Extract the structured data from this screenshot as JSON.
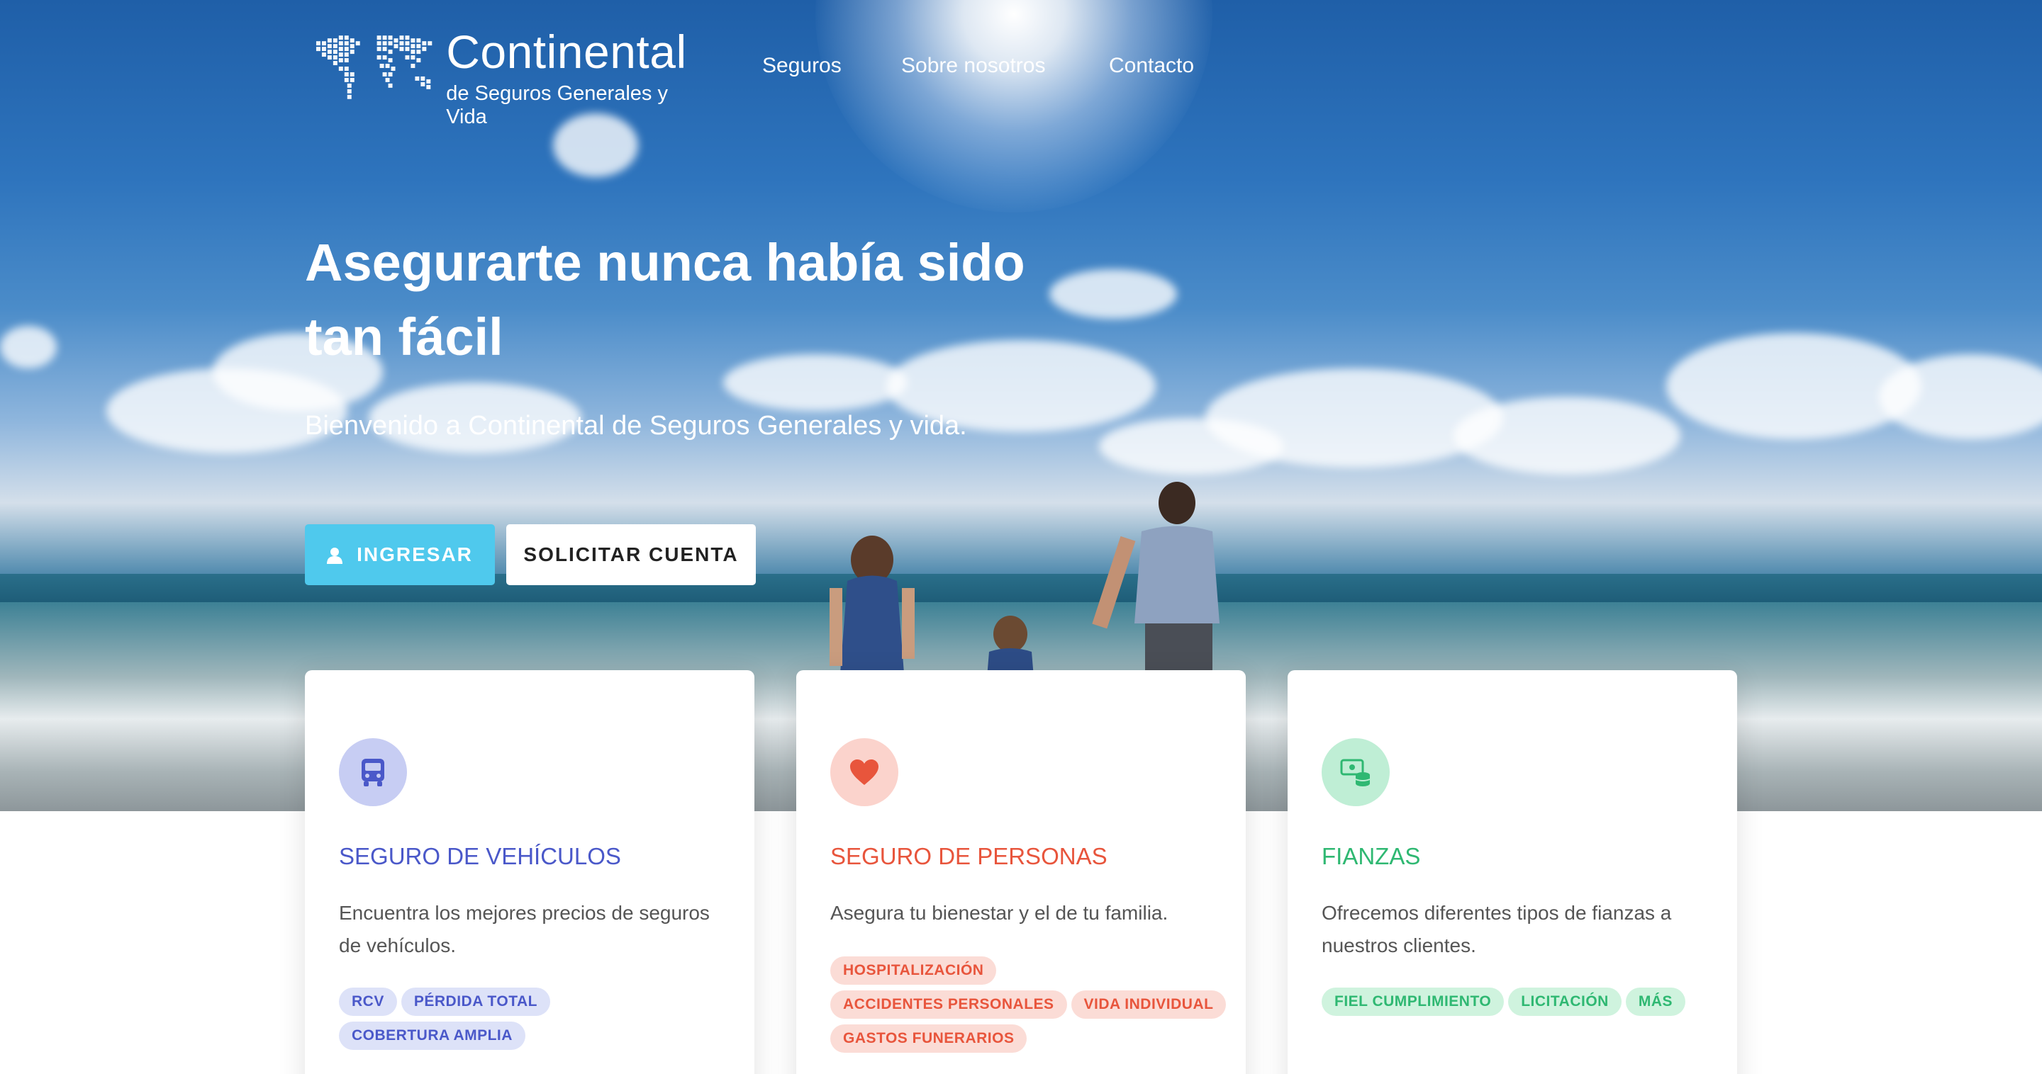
{
  "brand": {
    "name": "Continental",
    "tagline": "de Seguros Generales y Vida"
  },
  "nav": {
    "items": [
      {
        "label": "Seguros"
      },
      {
        "label": "Sobre nosotros"
      },
      {
        "label": "Contacto"
      }
    ]
  },
  "hero": {
    "title_line1": "Asegurarte nunca había sido",
    "title_line2": "tan fácil",
    "subtitle": "Bienvenido a Continental de Seguros Generales y vida.",
    "login_label": "INGRESAR",
    "login_icon": "user-icon",
    "signup_label": "SOLICITAR CUENTA"
  },
  "cards": [
    {
      "icon": "bus-icon",
      "title": "SEGURO DE VEHÍCULOS",
      "description": "Encuentra los mejores precios de seguros de vehículos.",
      "tags": [
        "RCV",
        "PÉRDIDA TOTAL",
        "COBERTURA AMPLIA"
      ],
      "accent": "#4a58c9",
      "icon_bg": "#c7cdf3",
      "tag_bg": "#dde2f8"
    },
    {
      "icon": "heart-icon",
      "title": "SEGURO DE PERSONAS",
      "description": "Asegura tu bienestar y el de tu familia.",
      "tags": [
        "HOSPITALIZACIÓN",
        "ACCIDENTES PERSONALES",
        "VIDA INDIVIDUAL",
        "GASTOS FUNERARIOS"
      ],
      "accent": "#e8553c",
      "icon_bg": "#fbd3cc",
      "tag_bg": "#fbdcd6"
    },
    {
      "icon": "money-stack-icon",
      "title": "FIANZAS",
      "description": "Ofrecemos diferentes tipos de fianzas a nuestros clientes.",
      "tags": [
        "FIEL CUMPLIMIENTO",
        "LICITACIÓN",
        "MÁS"
      ],
      "accent": "#2fb872",
      "icon_bg": "#bfeed5",
      "tag_bg": "#cff3de"
    }
  ]
}
